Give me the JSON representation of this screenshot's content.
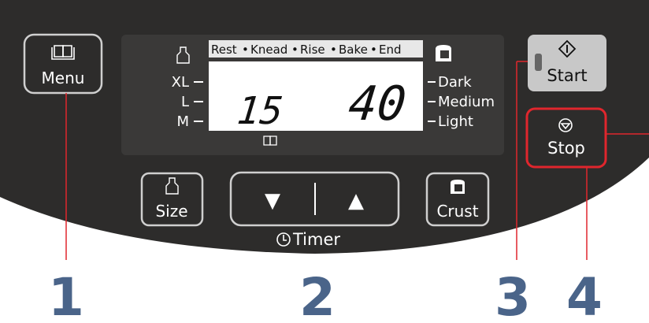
{
  "buttons": {
    "menu": "Menu",
    "size": "Size",
    "crust": "Crust",
    "start": "Start",
    "stop": "Stop",
    "down_arrow": "▼",
    "up_arrow": "▲"
  },
  "timer_label": "Timer",
  "display": {
    "stages": {
      "rest": "Rest",
      "knead": "Knead",
      "rise": "Rise",
      "bake": "Bake",
      "end": "End",
      "separator": "•"
    },
    "sizes": {
      "xl": "XL",
      "l": "L",
      "m": "M"
    },
    "crusts": {
      "dark": "Dark",
      "medium": "Medium",
      "light": "Light"
    },
    "menu_number": "15",
    "time": "40"
  },
  "callouts": [
    "1",
    "2",
    "3",
    "4"
  ],
  "icons": {
    "menu": "book-icon",
    "size": "loaf-size-icon",
    "crust": "bread-crust-icon",
    "start": "start-diamond-icon",
    "stop": "stop-circle-icon",
    "timer": "clock-icon"
  },
  "colors": {
    "panel": "#2d2c2b",
    "lcd_background": "#3a3938",
    "lcd_screen": "#ffffff",
    "start_button": "#c8c8c8",
    "stop_highlight": "#e0262d",
    "callout_numbers": "#4a6489",
    "start_indicator": "#666666"
  }
}
